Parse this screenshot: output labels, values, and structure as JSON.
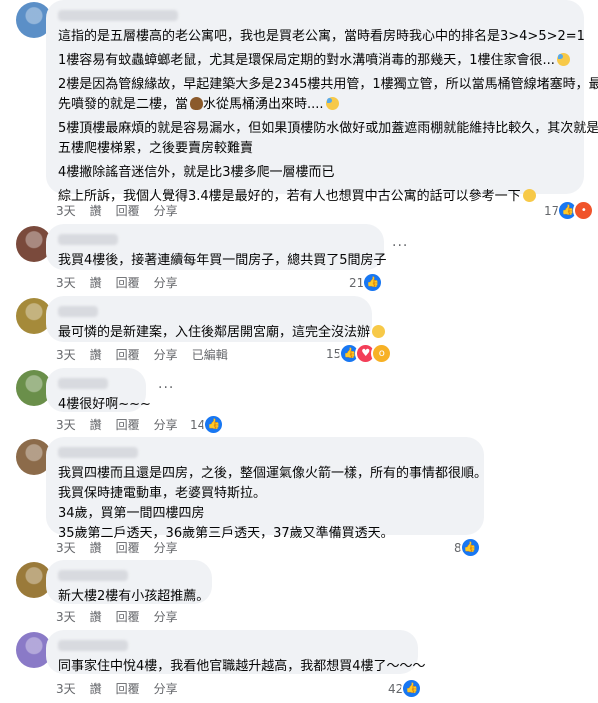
{
  "comments": [
    {
      "lines": [
        "這指的是五層樓高的老公寓吧，我也是買老公寓，當時看房時我心中的排名是3>4>5>2=1",
        "1樓容易有蚊蟲蟑螂老鼠，尤其是環保局定期的對水溝噴消毒的那幾天，1樓住家會很...",
        "2樓是因為管線緣故，早起建築大多是2345樓共用管，1樓獨立管，所以當馬桶管線堵塞時，最",
        "先噴發的就是二樓，當",
        "水從馬桶湧出來時....",
        "5樓頂樓最麻煩的就是容易漏水，但如果頂樓防水做好或加蓋遮雨棚就能維持比較久，其次就是",
        "五樓爬樓梯累，之後要賣房較難賣",
        "4樓撇除謠音迷信外，就是比3樓多爬一層樓而已",
        "綜上所訴，我個人覺得3.4樓是最好的，若有人也想買中古公寓的話可以參考一下"
      ],
      "time": "3天",
      "like": "讚",
      "reply": "回覆",
      "share": "分享",
      "reaction_count": "17",
      "reactions": [
        "like-icon",
        "angry-icon"
      ]
    },
    {
      "lines": [
        "我買4樓後，接著連續每年買一間房子，總共買了5間房子"
      ],
      "time": "3天",
      "like": "讚",
      "reply": "回覆",
      "share": "分享",
      "reaction_count": "21",
      "reactions": [
        "like-icon"
      ]
    },
    {
      "lines": [
        "最可憐的是新建案，入住後鄰居開宮廟，這完全沒法辦"
      ],
      "time": "3天",
      "like": "讚",
      "reply": "回覆",
      "share": "分享",
      "edited": "已編輯",
      "reaction_count": "15",
      "reactions": [
        "like-icon",
        "heart-icon",
        "wow-icon"
      ]
    },
    {
      "lines": [
        "4樓很好啊~~~"
      ],
      "time": "3天",
      "like": "讚",
      "reply": "回覆",
      "share": "分享",
      "reaction_count": "14",
      "reactions": [
        "like-icon"
      ]
    },
    {
      "lines": [
        "我買四樓而且還是四房，之後，整個運氣像火箭一樣，所有的事情都很順。",
        "我買保時捷電動車，老婆買特斯拉。",
        "34歲，買第一間四樓四房",
        "35歲第二戶透天，36歲第三戶透天，37歲又準備買透天。"
      ],
      "time": "3天",
      "like": "讚",
      "reply": "回覆",
      "share": "分享",
      "reaction_count": "8",
      "reactions": [
        "like-icon"
      ]
    },
    {
      "lines": [
        "新大樓2樓有小孩超推薦。"
      ],
      "time": "3天",
      "like": "讚",
      "reply": "回覆",
      "share": "分享",
      "reaction_count": "",
      "reactions": []
    },
    {
      "lines": [
        "同事家住中悅4樓，我看他官職越升越高，我都想買4樓了～～～"
      ],
      "time": "3天",
      "like": "讚",
      "reply": "回覆",
      "share": "分享",
      "reaction_count": "42",
      "reactions": [
        "like-icon"
      ]
    }
  ],
  "more_label": "···",
  "colors": {
    "like": "#1877f2",
    "angry": "#f0542b",
    "heart": "#f33e58",
    "wow": "#f7b125",
    "bubble": "#f0f2f5",
    "meta": "#65676b"
  }
}
